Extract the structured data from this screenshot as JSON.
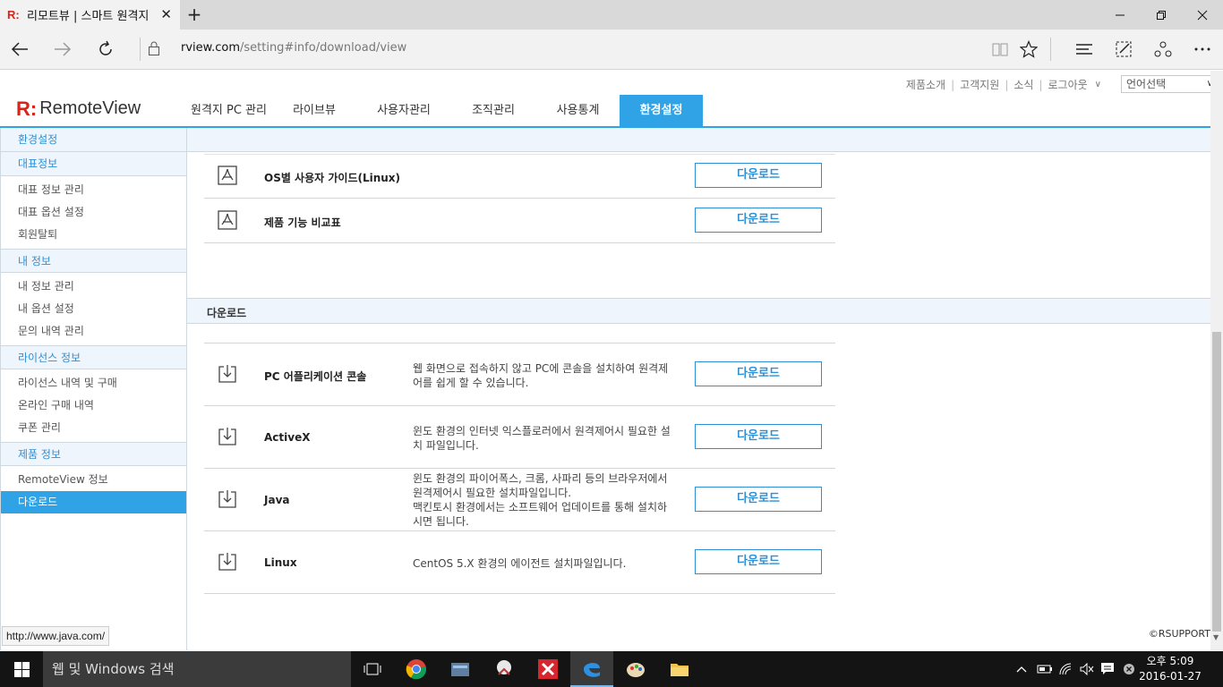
{
  "browser": {
    "tab_title": "리모트뷰 | 스마트 원격지",
    "url_host": "rview.com",
    "url_path": "/setting#info/download/view"
  },
  "header": {
    "top_links": [
      "제품소개",
      "고객지원",
      "소식",
      "로그아웃"
    ],
    "language_select": "언어선택",
    "logo_mark": "R:",
    "logo_text": "RemoteView",
    "nav": [
      "원격지 PC 관리",
      "라이브뷰",
      "사용자관리",
      "조직관리",
      "사용통계",
      "환경설정"
    ],
    "active_nav": "환경설정"
  },
  "sidebar": {
    "title": "환경설정",
    "sections": [
      {
        "label": "대표정보",
        "items": [
          "대표 정보 관리",
          "대표 옵션 설정",
          "회원탈퇴"
        ]
      },
      {
        "label": "내 정보",
        "items": [
          "내 정보 관리",
          "내 옵션 설정",
          "문의 내역 관리"
        ]
      },
      {
        "label": "라이선스 정보",
        "items": [
          "라이선스 내역 및 구매",
          "온라인 구매 내역",
          "쿠폰 관리"
        ]
      },
      {
        "label": "제품 정보",
        "items": [
          "RemoteView 정보",
          "다운로드"
        ]
      }
    ],
    "active_item": "다운로드"
  },
  "content": {
    "guides": [
      {
        "name": "OS별 사용자 가이드(Linux)",
        "button": "다운로드"
      },
      {
        "name": "제품 기능 비교표",
        "button": "다운로드"
      }
    ],
    "download_section_title": "다운로드",
    "downloads": [
      {
        "name": "PC 어플리케이션 콘솔",
        "desc": "웹 화면으로 접속하지 않고 PC에 콘솔을 설치하여 원격제어를 쉽게 할 수 있습니다.",
        "button": "다운로드"
      },
      {
        "name": "ActiveX",
        "desc": "윈도 환경의 인터넷 익스플로러에서 원격제어시 필요한 설치 파일입니다.",
        "button": "다운로드"
      },
      {
        "name": "Java",
        "desc": "윈도 환경의 파이어폭스, 크롬, 사파리 등의 브라우저에서 원격제어시 필요한 설치파일입니다.\n맥킨토시 환경에서는 소프트웨어 업데이트를 통해 설치하시면 됩니다.",
        "button": "다운로드"
      },
      {
        "name": "Linux",
        "desc": "CentOS 5.X 환경의 에이전트 설치파일입니다.",
        "button": "다운로드"
      }
    ],
    "copyright": "©RSUPPORT",
    "status_url": "http://www.java.com/"
  },
  "taskbar": {
    "search_placeholder": "웹 및 Windows 검색",
    "time": "오후 5:09",
    "date": "2016-01-27"
  },
  "colors": {
    "accent": "#2fa3e6",
    "link": "#2f8fd4",
    "brand_red": "#d6251b",
    "sidebar_bg": "#eef5fc"
  }
}
